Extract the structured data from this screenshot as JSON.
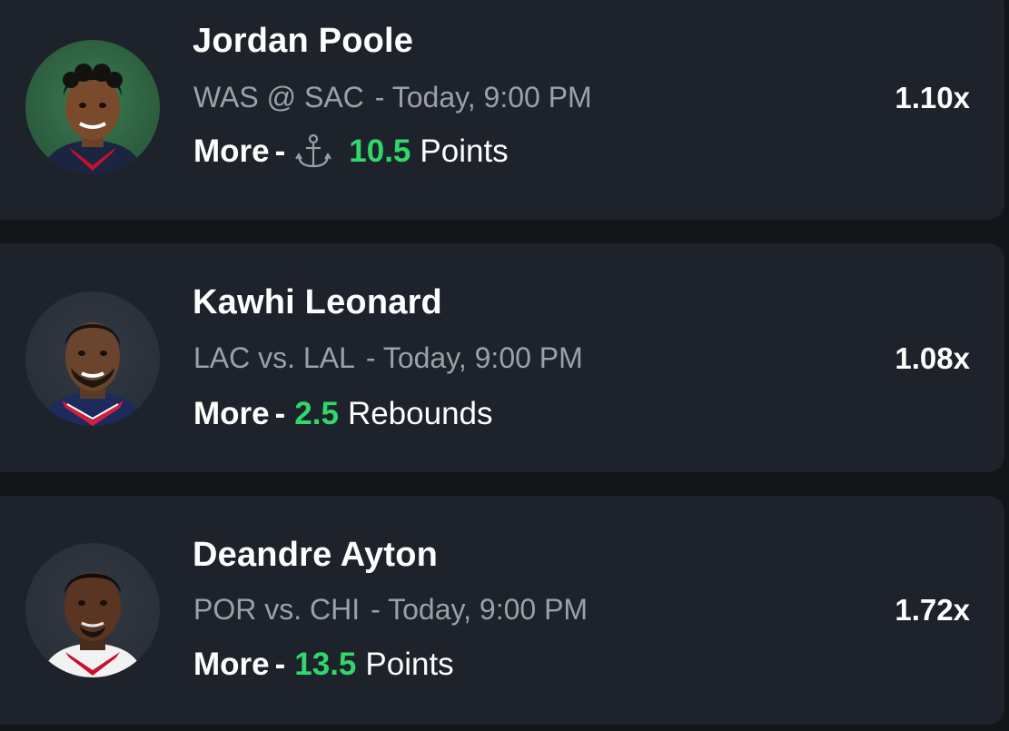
{
  "colors": {
    "background": "#131518",
    "card": "#1e222a",
    "accent_green": "#2fd86b",
    "muted_text": "#9ca1a9"
  },
  "picks": [
    {
      "player": "Jordan Poole",
      "matchup": "WAS @ SAC",
      "time": "- Today, 9:00 PM",
      "direction": "More",
      "dash": "-",
      "icon": "anchor-icon",
      "line": "10.5",
      "stat": "Points",
      "multiplier": "1.10x"
    },
    {
      "player": "Kawhi Leonard",
      "matchup": "LAC vs. LAL",
      "time": "- Today, 9:00 PM",
      "direction": "More",
      "dash": "-",
      "line": "2.5",
      "stat": "Rebounds",
      "multiplier": "1.08x"
    },
    {
      "player": "Deandre Ayton",
      "matchup": "POR vs. CHI",
      "time": "- Today, 9:00 PM",
      "direction": "More",
      "dash": "-",
      "line": "13.5",
      "stat": "Points",
      "multiplier": "1.72x"
    }
  ]
}
